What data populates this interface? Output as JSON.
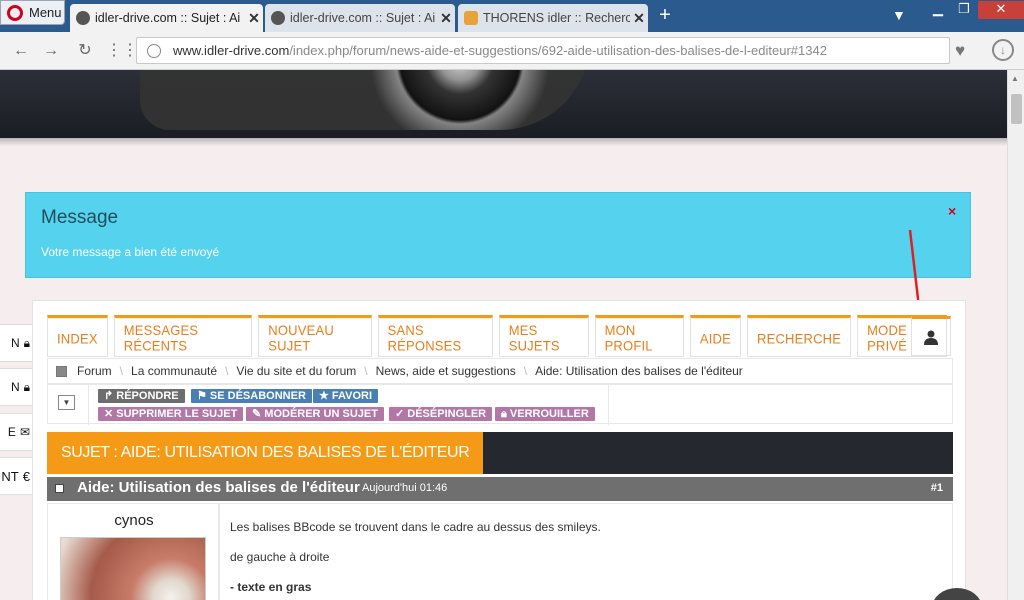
{
  "browser": {
    "menu_label": "Menu",
    "tabs": [
      {
        "title": "idler-drive.com :: Sujet : Ai",
        "active": true
      },
      {
        "title": "idler-drive.com :: Sujet : Ai",
        "active": false
      },
      {
        "title": "THORENS idler :: Recherch",
        "active": false
      }
    ],
    "address": {
      "domain": "www.idler-drive.com",
      "path": "/index.php/forum/news-aide-et-suggestions/692-aide-utilisation-des-balises-de-l-editeur#1342"
    },
    "icons": {
      "back": "back-arrow-icon",
      "forward": "forward-arrow-icon",
      "reload": "reload-icon",
      "speeddial": "grid-icon",
      "heart": "heart-icon",
      "download": "download-icon"
    }
  },
  "message": {
    "title": "Message",
    "text": "Votre message a bien été envoyé",
    "close": "×"
  },
  "side_tabs": [
    {
      "label": "N",
      "icon": "lock-icon"
    },
    {
      "label": "N",
      "icon": "lock-icon"
    },
    {
      "label": "E",
      "icon": "envelope-icon"
    },
    {
      "label": "NT",
      "icon": "euro-icon"
    }
  ],
  "forum_menu": [
    "INDEX",
    "MESSAGES RÉCENTS",
    "NOUVEAU SUJET",
    "SANS RÉPONSES",
    "MES SUJETS",
    "MON PROFIL",
    "AIDE",
    "RECHERCHE",
    "MODE PRIVÉ"
  ],
  "breadcrumb": [
    "Forum",
    "La communauté",
    "Vie du site et du forum",
    "News, aide et suggestions",
    "Aide: Utilisation des balises de l'éditeur"
  ],
  "actions": {
    "row1": [
      {
        "label": "RÉPONDRE",
        "icon": "reply-icon",
        "color": "gray"
      },
      {
        "label": "SE DÉSABONNER",
        "icon": "flag-icon",
        "color": "blue"
      },
      {
        "label": "FAVORI",
        "icon": "star-icon",
        "color": "blue"
      }
    ],
    "row2": [
      {
        "label": "SUPPRIMER LE SUJET",
        "icon": "x-icon",
        "color": "purple"
      },
      {
        "label": "MODÉRER UN SUJET",
        "icon": "wrench-icon",
        "color": "purple"
      },
      {
        "label": "DÉSÉPINGLER",
        "icon": "check-icon",
        "color": "purple"
      },
      {
        "label": "VERROUILLER",
        "icon": "lock-icon",
        "color": "purple"
      }
    ]
  },
  "topic": {
    "header": "SUJET : AIDE: UTILISATION DES BALISES DE L'ÉDITEUR",
    "subject": "Aide: Utilisation des balises de l'éditeur",
    "date": "Aujourd'hui 01:46",
    "number": "#1",
    "author": "cynos",
    "lines": [
      "Les balises BBcode se trouvent dans le cadre au dessus des smileys.",
      "de gauche à droite",
      "- texte en gras"
    ]
  },
  "colors": {
    "accent": "#f29b1b",
    "message_bg": "#55d3ee",
    "titlebar": "#2b5a8e",
    "arrow": "#e02020"
  }
}
